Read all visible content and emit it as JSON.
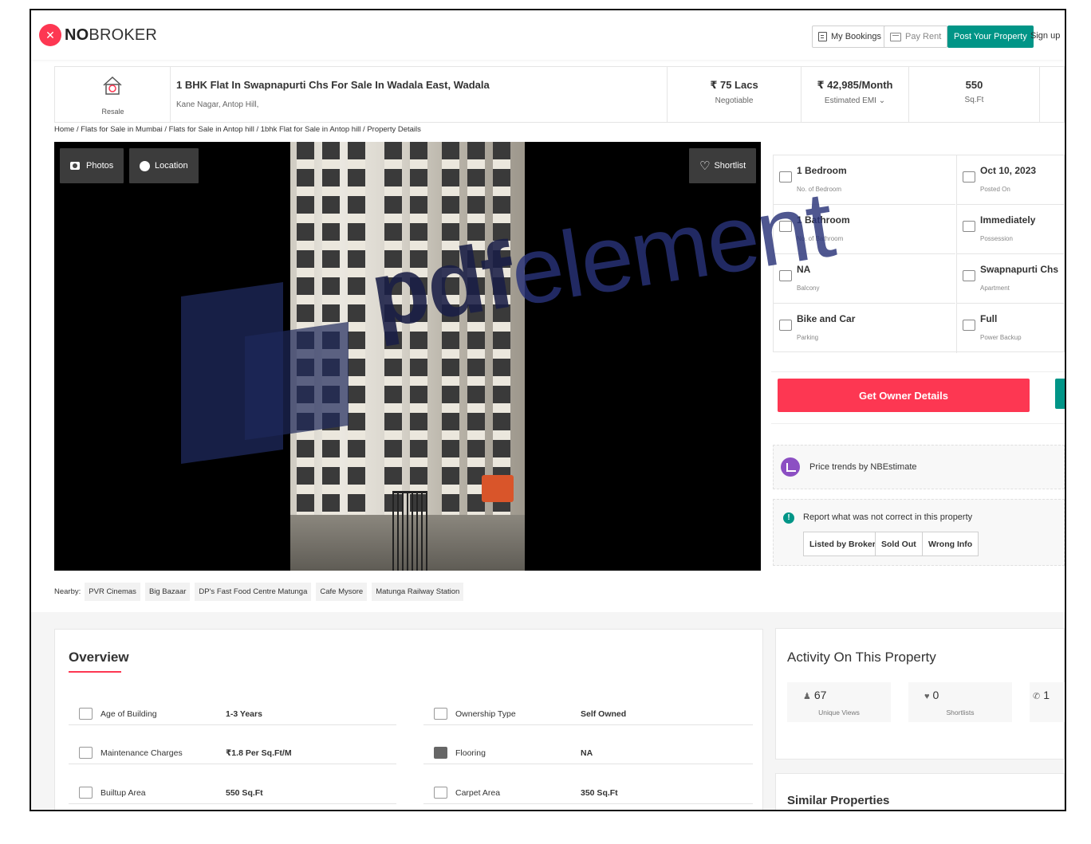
{
  "header": {
    "logo_bold": "NO",
    "logo_rest": "BROKER",
    "my_bookings": "My Bookings",
    "pay_rent": "Pay Rent",
    "post_property": "Post Your Property",
    "sign_up": "Sign up"
  },
  "property": {
    "type_label": "Resale",
    "title": "1 BHK Flat In Swapnapurti Chs For Sale In Wadala East, Wadala",
    "address": "Kane Nagar, Antop Hill,",
    "price": "₹ 75 Lacs",
    "price_note": "Negotiable",
    "emi": "₹ 42,985/Month",
    "emi_label": "Estimated EMI ⌄",
    "area": "550",
    "area_unit": "Sq.Ft"
  },
  "breadcrumb": "Home / Flats for Sale in Mumbai / Flats for Sale in Antop hill / 1bhk Flat for Sale in Antop hill / Property Details",
  "gallery": {
    "photos": "Photos",
    "location": "Location",
    "shortlist": "Shortlist"
  },
  "nearby": {
    "label": "Nearby:",
    "places": [
      "PVR Cinemas",
      "Big Bazaar",
      "DP's Fast Food Centre Matunga",
      "Cafe Mysore",
      "Matunga Railway Station"
    ]
  },
  "attributes": [
    {
      "value": "1 Bedroom",
      "label": "No. of Bedroom",
      "icon": "bed-icon"
    },
    {
      "value": "Oct 10, 2023",
      "label": "Posted On",
      "icon": "calendar-icon"
    },
    {
      "value": "1 Bathroom",
      "label": "No. of Bathroom",
      "icon": "bathtub-icon"
    },
    {
      "value": "Immediately",
      "label": "Possession",
      "icon": "key-icon"
    },
    {
      "value": "NA",
      "label": "Balcony",
      "icon": "balcony-icon"
    },
    {
      "value": "Swapnapurti Chs",
      "label": "Apartment",
      "icon": "building-icon"
    },
    {
      "value": "Bike and Car",
      "label": "Parking",
      "icon": "car-icon"
    },
    {
      "value": "Full",
      "label": "Power Backup",
      "icon": "battery-icon"
    }
  ],
  "actions": {
    "owner_details": "Get Owner Details",
    "price_trends": "Price trends by NBEstimate",
    "report_text": "Report what was not correct in this property",
    "listed_by_broker": "Listed by Broker",
    "sold_out": "Sold Out",
    "wrong_info": "Wrong Info"
  },
  "overview": {
    "title": "Overview",
    "rows": [
      {
        "label": "Age of Building",
        "value": "1-3 Years",
        "icon": "building-age-icon"
      },
      {
        "label": "Ownership Type",
        "value": "Self Owned",
        "icon": "owner-icon"
      },
      {
        "label": "Maintenance Charges",
        "value": "₹1.8 Per Sq.Ft/M",
        "icon": "tools-icon"
      },
      {
        "label": "Flooring",
        "value": "NA",
        "icon": "flooring-icon"
      },
      {
        "label": "Builtup Area",
        "value": "550 Sq.Ft",
        "icon": "builtup-icon"
      },
      {
        "label": "Carpet Area",
        "value": "350 Sq.Ft",
        "icon": "carpet-icon"
      }
    ]
  },
  "activity": {
    "title": "Activity On This Property",
    "views": "67",
    "views_label": "Unique Views",
    "shortlists": "0",
    "shortlists_label": "Shortlists",
    "contacts": "1"
  },
  "similar": {
    "title": "Similar Properties"
  },
  "watermark": {
    "bold": "pdf",
    "rest": "element"
  },
  "colors": {
    "brand": "#fd3752",
    "teal": "#009587",
    "purple": "#8c4fc3"
  }
}
